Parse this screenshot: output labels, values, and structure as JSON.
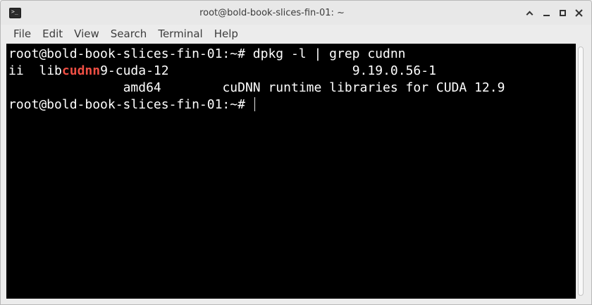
{
  "window": {
    "title": "root@bold-book-slices-fin-01: ~",
    "app_icon_glyph": ">_"
  },
  "menu": {
    "items": [
      "File",
      "Edit",
      "View",
      "Search",
      "Terminal",
      "Help"
    ]
  },
  "terminal": {
    "prompt": "root@bold-book-slices-fin-01:~# ",
    "command": "dpkg -l | grep cudnn",
    "output": {
      "status": "ii",
      "pkg_prefix": "lib",
      "pkg_match": "cudnn",
      "pkg_suffix": "9-cuda-12",
      "version": "9.19.0.56-1",
      "arch": "amd64",
      "description": "cuDNN runtime libraries for CUDA 12.9"
    },
    "colors": {
      "background": "#000000",
      "foreground": "#ffffff",
      "match": "#ef4f44"
    }
  }
}
